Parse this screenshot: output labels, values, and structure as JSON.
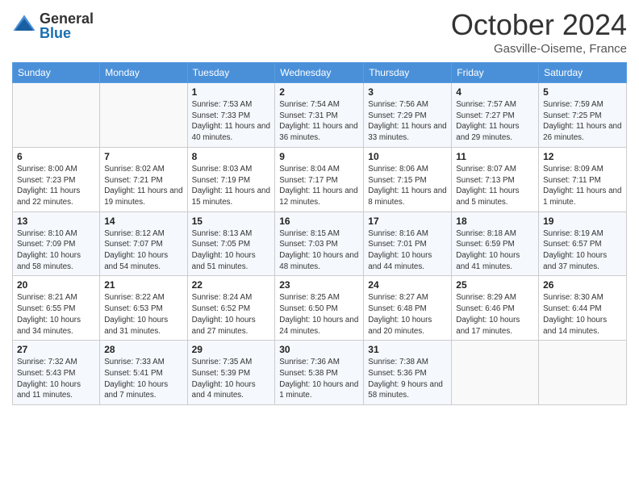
{
  "logo": {
    "line1": "General",
    "line2": "Blue"
  },
  "header": {
    "title": "October 2024",
    "location": "Gasville-Oiseme, France"
  },
  "days": [
    "Sunday",
    "Monday",
    "Tuesday",
    "Wednesday",
    "Thursday",
    "Friday",
    "Saturday"
  ],
  "weeks": [
    [
      null,
      null,
      {
        "day": 1,
        "sunrise": "7:53 AM",
        "sunset": "7:33 PM",
        "daylight": "11 hours and 40 minutes."
      },
      {
        "day": 2,
        "sunrise": "7:54 AM",
        "sunset": "7:31 PM",
        "daylight": "11 hours and 36 minutes."
      },
      {
        "day": 3,
        "sunrise": "7:56 AM",
        "sunset": "7:29 PM",
        "daylight": "11 hours and 33 minutes."
      },
      {
        "day": 4,
        "sunrise": "7:57 AM",
        "sunset": "7:27 PM",
        "daylight": "11 hours and 29 minutes."
      },
      {
        "day": 5,
        "sunrise": "7:59 AM",
        "sunset": "7:25 PM",
        "daylight": "11 hours and 26 minutes."
      }
    ],
    [
      {
        "day": 6,
        "sunrise": "8:00 AM",
        "sunset": "7:23 PM",
        "daylight": "11 hours and 22 minutes."
      },
      {
        "day": 7,
        "sunrise": "8:02 AM",
        "sunset": "7:21 PM",
        "daylight": "11 hours and 19 minutes."
      },
      {
        "day": 8,
        "sunrise": "8:03 AM",
        "sunset": "7:19 PM",
        "daylight": "11 hours and 15 minutes."
      },
      {
        "day": 9,
        "sunrise": "8:04 AM",
        "sunset": "7:17 PM",
        "daylight": "11 hours and 12 minutes."
      },
      {
        "day": 10,
        "sunrise": "8:06 AM",
        "sunset": "7:15 PM",
        "daylight": "11 hours and 8 minutes."
      },
      {
        "day": 11,
        "sunrise": "8:07 AM",
        "sunset": "7:13 PM",
        "daylight": "11 hours and 5 minutes."
      },
      {
        "day": 12,
        "sunrise": "8:09 AM",
        "sunset": "7:11 PM",
        "daylight": "11 hours and 1 minute."
      }
    ],
    [
      {
        "day": 13,
        "sunrise": "8:10 AM",
        "sunset": "7:09 PM",
        "daylight": "10 hours and 58 minutes."
      },
      {
        "day": 14,
        "sunrise": "8:12 AM",
        "sunset": "7:07 PM",
        "daylight": "10 hours and 54 minutes."
      },
      {
        "day": 15,
        "sunrise": "8:13 AM",
        "sunset": "7:05 PM",
        "daylight": "10 hours and 51 minutes."
      },
      {
        "day": 16,
        "sunrise": "8:15 AM",
        "sunset": "7:03 PM",
        "daylight": "10 hours and 48 minutes."
      },
      {
        "day": 17,
        "sunrise": "8:16 AM",
        "sunset": "7:01 PM",
        "daylight": "10 hours and 44 minutes."
      },
      {
        "day": 18,
        "sunrise": "8:18 AM",
        "sunset": "6:59 PM",
        "daylight": "10 hours and 41 minutes."
      },
      {
        "day": 19,
        "sunrise": "8:19 AM",
        "sunset": "6:57 PM",
        "daylight": "10 hours and 37 minutes."
      }
    ],
    [
      {
        "day": 20,
        "sunrise": "8:21 AM",
        "sunset": "6:55 PM",
        "daylight": "10 hours and 34 minutes."
      },
      {
        "day": 21,
        "sunrise": "8:22 AM",
        "sunset": "6:53 PM",
        "daylight": "10 hours and 31 minutes."
      },
      {
        "day": 22,
        "sunrise": "8:24 AM",
        "sunset": "6:52 PM",
        "daylight": "10 hours and 27 minutes."
      },
      {
        "day": 23,
        "sunrise": "8:25 AM",
        "sunset": "6:50 PM",
        "daylight": "10 hours and 24 minutes."
      },
      {
        "day": 24,
        "sunrise": "8:27 AM",
        "sunset": "6:48 PM",
        "daylight": "10 hours and 20 minutes."
      },
      {
        "day": 25,
        "sunrise": "8:29 AM",
        "sunset": "6:46 PM",
        "daylight": "10 hours and 17 minutes."
      },
      {
        "day": 26,
        "sunrise": "8:30 AM",
        "sunset": "6:44 PM",
        "daylight": "10 hours and 14 minutes."
      }
    ],
    [
      {
        "day": 27,
        "sunrise": "7:32 AM",
        "sunset": "5:43 PM",
        "daylight": "10 hours and 11 minutes."
      },
      {
        "day": 28,
        "sunrise": "7:33 AM",
        "sunset": "5:41 PM",
        "daylight": "10 hours and 7 minutes."
      },
      {
        "day": 29,
        "sunrise": "7:35 AM",
        "sunset": "5:39 PM",
        "daylight": "10 hours and 4 minutes."
      },
      {
        "day": 30,
        "sunrise": "7:36 AM",
        "sunset": "5:38 PM",
        "daylight": "10 hours and 1 minute."
      },
      {
        "day": 31,
        "sunrise": "7:38 AM",
        "sunset": "5:36 PM",
        "daylight": "9 hours and 58 minutes."
      },
      null,
      null
    ]
  ]
}
